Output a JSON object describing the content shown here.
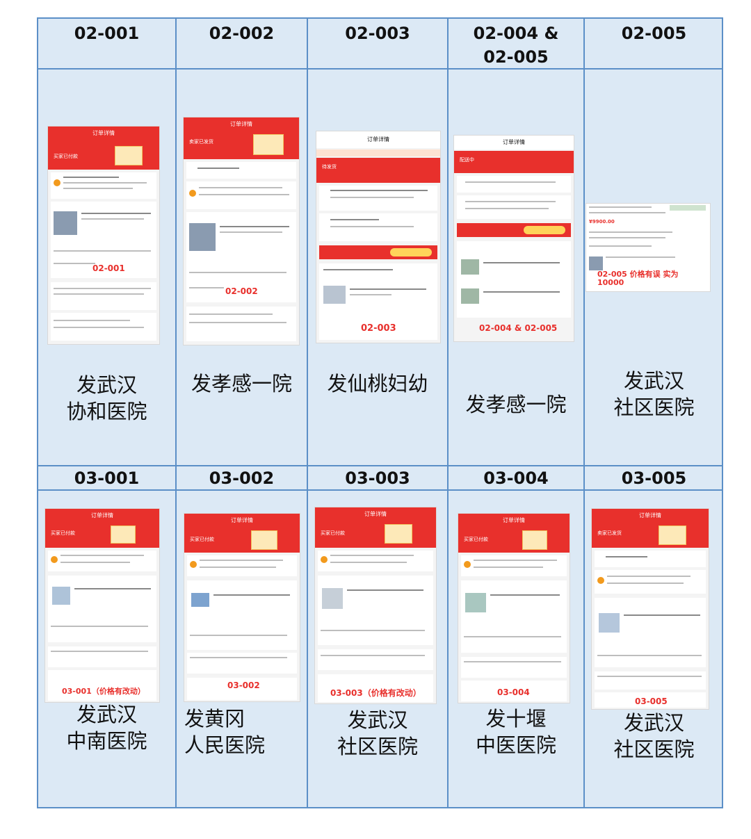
{
  "row1": {
    "headers": [
      "02-001",
      "02-002",
      "02-003",
      [
        "02-004 &",
        "02-005"
      ],
      "02-005"
    ],
    "shots": [
      {
        "title": "订单详情",
        "status": "买家已付款",
        "code": "02-001"
      },
      {
        "title": "订单详情",
        "status": "卖家已发货",
        "code": "02-002"
      },
      {
        "title": "订单详情",
        "status": "待发货",
        "code": "02-003"
      },
      {
        "title": "订单详情",
        "status": "配送中",
        "code": "02-004 & 02-005"
      },
      {
        "title": "",
        "status": "",
        "code": "02-005 价格有误 实为 10000"
      }
    ],
    "labels": [
      [
        "发武汉",
        "协和医院"
      ],
      [
        "发孝感一院"
      ],
      [
        "发仙桃妇幼"
      ],
      [
        "发孝感一院"
      ],
      [
        "发武汉",
        "社区医院"
      ]
    ]
  },
  "row2": {
    "headers": [
      "03-001",
      "03-002",
      "03-003",
      "03-004",
      "03-005"
    ],
    "shots": [
      {
        "title": "订单详情",
        "status": "买家已付款",
        "code": "03-001（价格有改动）"
      },
      {
        "title": "订单详情",
        "status": "买家已付款",
        "code": "03-002"
      },
      {
        "title": "订单详情",
        "status": "买家已付款",
        "code": "03-003（价格有改动）"
      },
      {
        "title": "订单详情",
        "status": "买家已付款",
        "code": "03-004"
      },
      {
        "title": "订单详情",
        "status": "卖家已发货",
        "code": "03-005"
      }
    ],
    "labels": [
      [
        "发武汉",
        "中南医院"
      ],
      [
        "发黄冈",
        "人民医院"
      ],
      [
        "发武汉",
        "社区医院"
      ],
      [
        "发十堰",
        "中医医院"
      ],
      [
        "发武汉",
        "社区医院"
      ]
    ]
  },
  "colors": {
    "border": "#5b8fc7",
    "cell_bg": "#dce9f5",
    "accent_red": "#e8302c"
  }
}
